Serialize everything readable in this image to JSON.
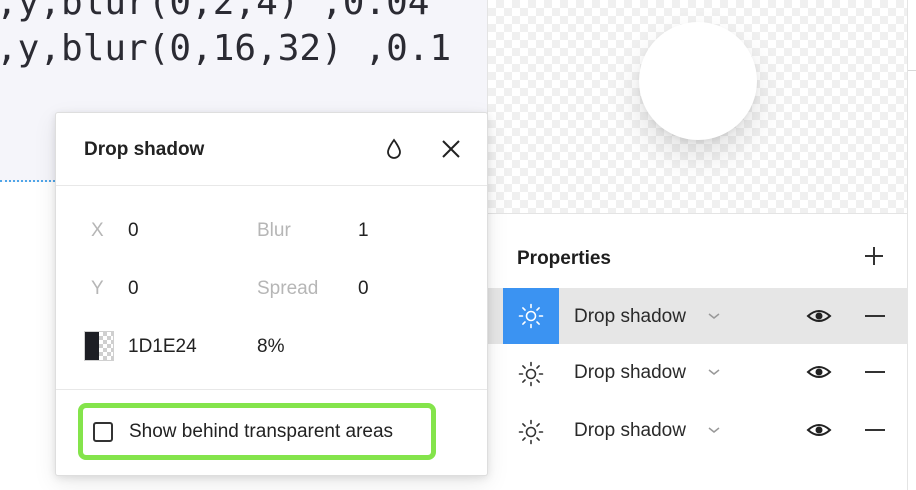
{
  "code_background": {
    "line1": ",y,blur(0,2,4) ,0.04",
    "line2": ",y,blur(0,16,32) ,0.1"
  },
  "popover": {
    "title": "Drop shadow",
    "icons": {
      "drop": "droplet-icon",
      "close": "close-icon"
    },
    "x_label": "X",
    "x_value": "0",
    "y_label": "Y",
    "y_value": "0",
    "blur_label": "Blur",
    "blur_value": "1",
    "spread_label": "Spread",
    "spread_value": "0",
    "color_hex": "1D1E24",
    "color_opacity": "8%",
    "color_swatch": "#1D1E24",
    "show_behind_label": "Show behind transparent areas",
    "show_behind_checked": false,
    "highlight_color": "#84E44B"
  },
  "properties": {
    "title": "Properties",
    "add_icon": "plus-icon",
    "items": [
      {
        "label": "Drop shadow",
        "selected": true
      },
      {
        "label": "Drop shadow",
        "selected": false
      },
      {
        "label": "Drop shadow",
        "selected": false
      }
    ],
    "selected_color": "#3B93F2"
  }
}
